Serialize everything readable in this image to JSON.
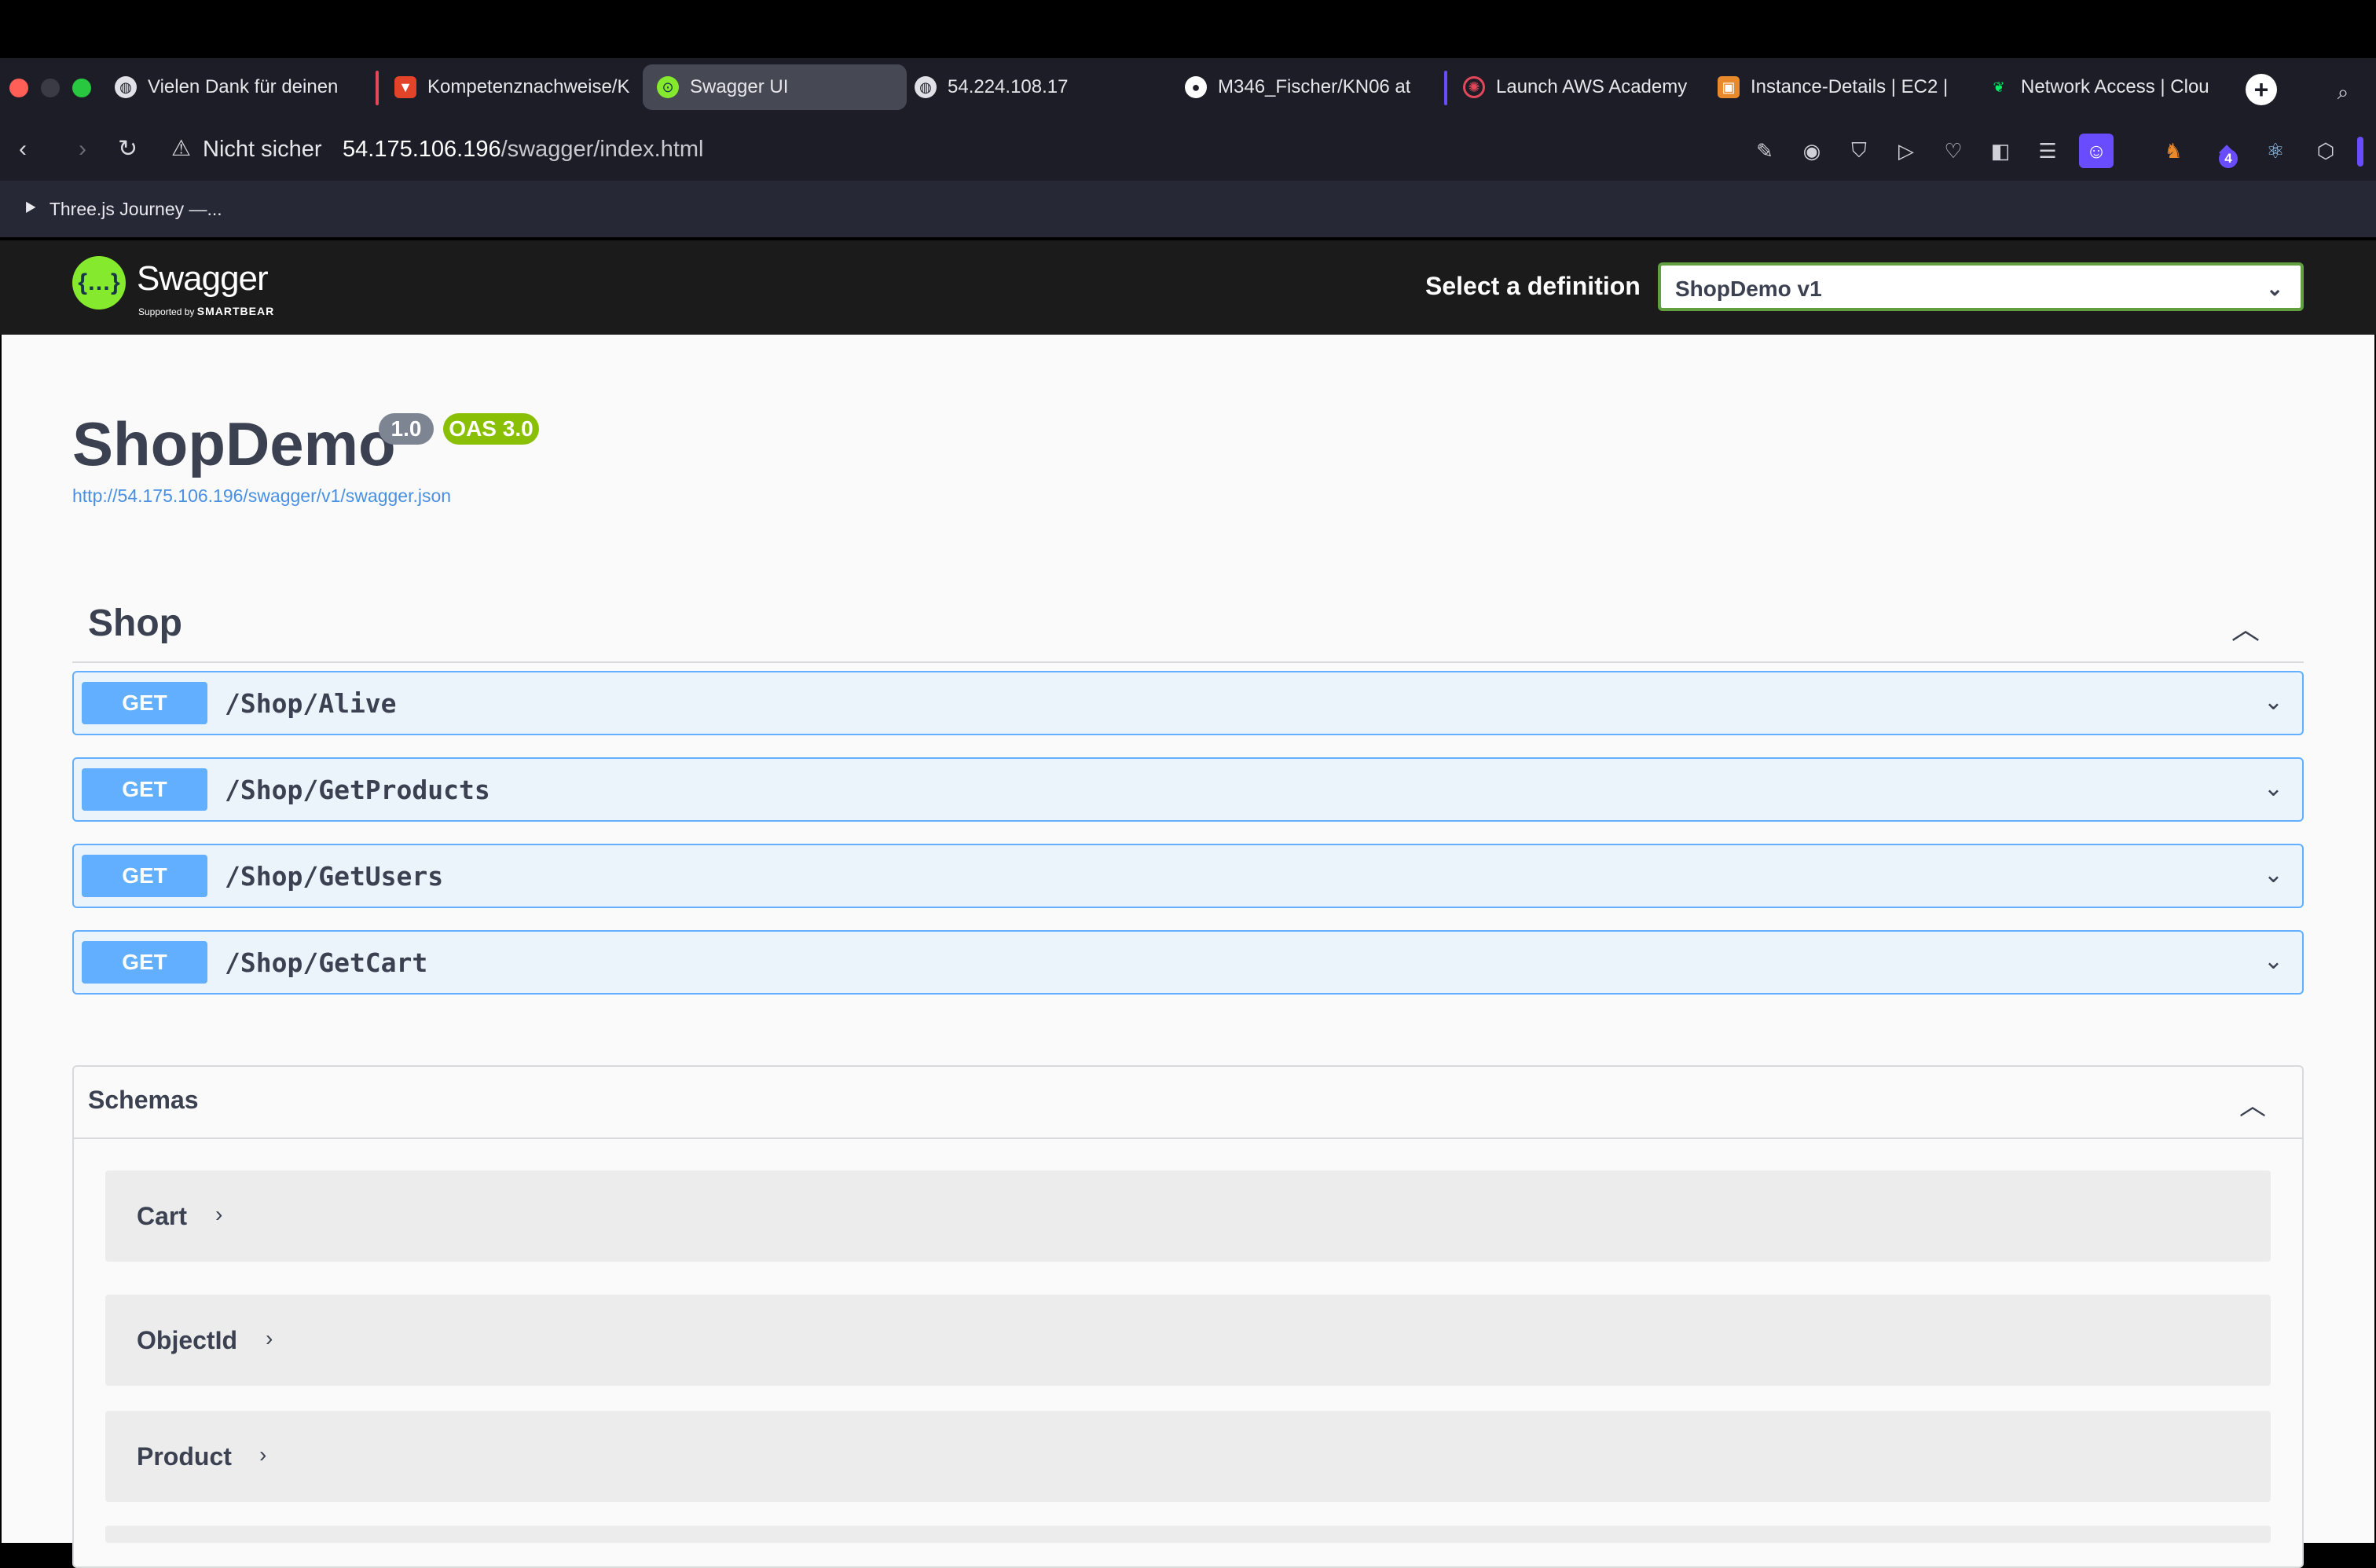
{
  "browser": {
    "tabs": [
      {
        "label": "Vielen Dank für deinen",
        "icon": "globe-icon"
      },
      {
        "label": "Kompetenznachweise/K",
        "icon": "gitlab-icon"
      },
      {
        "label": "Swagger UI",
        "icon": "swagger-icon"
      },
      {
        "label": "54.224.108.17",
        "icon": "globe-icon"
      },
      {
        "label": "M346_Fischer/KN06 at",
        "icon": "github-icon"
      },
      {
        "label": "Launch AWS Academy",
        "icon": "aws-academy-icon"
      },
      {
        "label": "Instance-Details | EC2 |",
        "icon": "aws-ec2-icon"
      },
      {
        "label": "Network Access | Clou",
        "icon": "mongodb-leaf-icon"
      }
    ],
    "address": {
      "security": "Nicht sicher",
      "host": "54.175.106.196",
      "path": "/swagger/index.html"
    },
    "extension_badge": "4",
    "bookmarks": [
      "Three.js Journey —..."
    ]
  },
  "topbar": {
    "brand": "Swagger",
    "brand_sub_prefix": "Supported by",
    "brand_sub": "SMARTBEAR",
    "select_label": "Select a definition",
    "selected_definition": "ShopDemo v1"
  },
  "info": {
    "title": "ShopDemo",
    "version": "1.0",
    "oas": "OAS 3.0",
    "spec_url": "http://54.175.106.196/swagger/v1/swagger.json"
  },
  "tag": {
    "name": "Shop",
    "operations": [
      {
        "method": "GET",
        "path": "/Shop/Alive"
      },
      {
        "method": "GET",
        "path": "/Shop/GetProducts"
      },
      {
        "method": "GET",
        "path": "/Shop/GetUsers"
      },
      {
        "method": "GET",
        "path": "/Shop/GetCart"
      }
    ]
  },
  "schemas": {
    "title": "Schemas",
    "models": [
      "Cart",
      "ObjectId",
      "Product"
    ]
  },
  "colors": {
    "get": "#61affe",
    "swagger_green": "#85ea2d",
    "version_badge": "#7d8492",
    "oas_badge": "#89bf04"
  }
}
